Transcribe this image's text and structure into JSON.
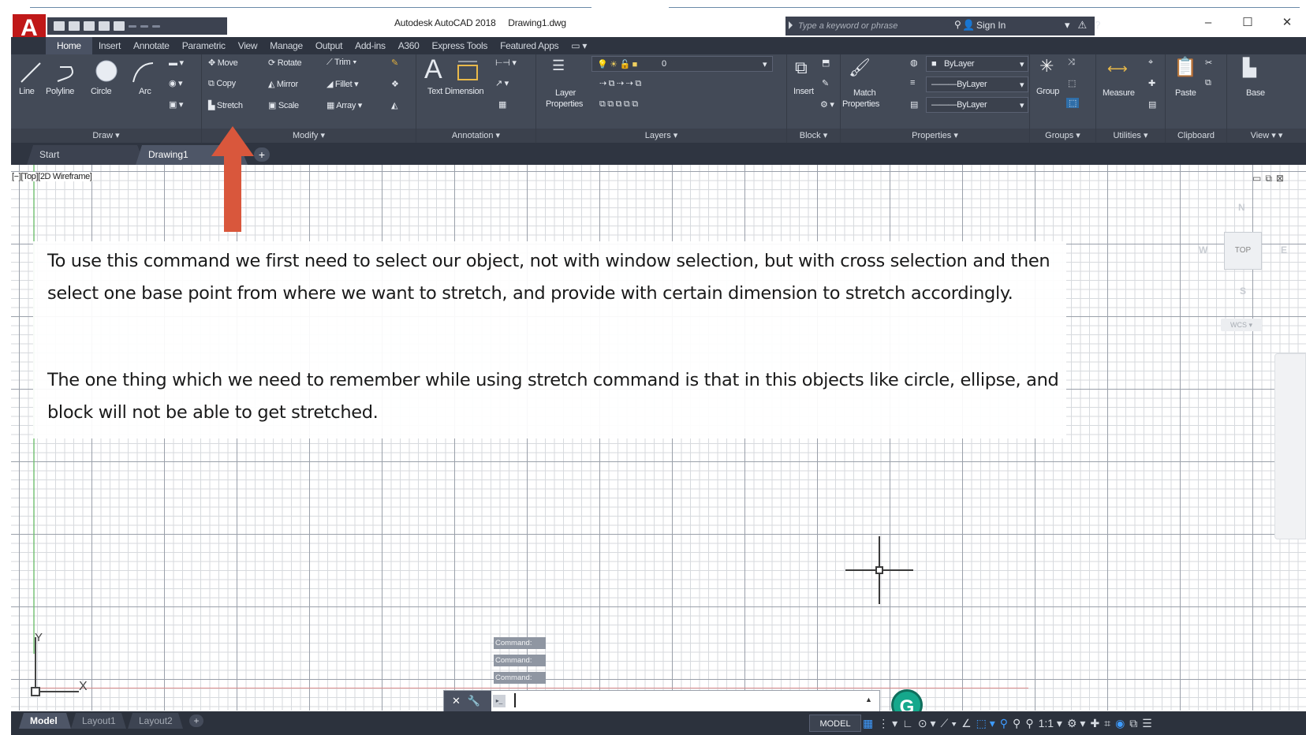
{
  "window": {
    "app_title": "Autodesk AutoCAD 2018",
    "doc_title": "Drawing1.dwg",
    "app_logo_letter": "A",
    "minimize": "–",
    "maximize": "☐",
    "close": "✕"
  },
  "search": {
    "placeholder": "Type a keyword or phrase"
  },
  "account": {
    "sign_in": "Sign In"
  },
  "ribbon_tabs": [
    "Home",
    "Insert",
    "Annotate",
    "Parametric",
    "View",
    "Manage",
    "Output",
    "Add-ins",
    "A360",
    "Express Tools",
    "Featured Apps"
  ],
  "panels": {
    "draw": {
      "title": "Draw ▾",
      "tools": [
        "Line",
        "Polyline",
        "Circle",
        "Arc"
      ]
    },
    "modify": {
      "title": "Modify ▾",
      "tools": [
        "Move",
        "Rotate",
        "Trim",
        "Copy",
        "Mirror",
        "Fillet",
        "Stretch",
        "Scale",
        "Array"
      ]
    },
    "annotation": {
      "title": "Annotation ▾",
      "tools": [
        "Text",
        "Dimension"
      ]
    },
    "layers": {
      "title": "Layers ▾",
      "tool": "Layer",
      "tool2": "Properties",
      "current_layer": "0"
    },
    "block": {
      "title": "Block ▾",
      "tool": "Insert"
    },
    "properties": {
      "title": "Properties ▾",
      "tool": "Match",
      "tool2": "Properties",
      "color": "ByLayer",
      "linetype": "ByLayer",
      "lineweight": "ByLayer"
    },
    "groups": {
      "title": "Groups ▾",
      "tool": "Group"
    },
    "utilities": {
      "title": "Utilities ▾",
      "tool": "Measure"
    },
    "clipboard": {
      "title": "Clipboard",
      "tool": "Paste"
    },
    "view": {
      "title": "View ▾",
      "tool": "Base"
    }
  },
  "file_tabs": {
    "start": "Start",
    "drawing": "Drawing1",
    "plus": "+"
  },
  "viewport": {
    "label": "[−][Top][2D Wireframe]",
    "viewcube": {
      "n": "N",
      "s": "S",
      "e": "E",
      "w": "W",
      "top": "TOP",
      "wcs": "WCS ▾"
    },
    "ucs": {
      "x": "X",
      "y": "Y"
    }
  },
  "callout": {
    "paragraph1": "To use this command we first need to select our object, not with window selection, but with cross selection and then select one base point from where we want to stretch, and provide with certain dimension to stretch accordingly.",
    "paragraph2": "The one thing which we need to remember while using stretch command is that in this objects like circle, ellipse, and block will not be able to get stretched."
  },
  "command": {
    "history": [
      "Command:",
      "Command:",
      "Command:"
    ],
    "placeholder": ""
  },
  "layout_tabs": [
    "Model",
    "Layout1",
    "Layout2"
  ],
  "status": {
    "space": "MODEL"
  },
  "colors": {
    "accent_red": "#d9573c",
    "ribbon_bg": "#434a57",
    "grammarly": "#15a88c"
  }
}
